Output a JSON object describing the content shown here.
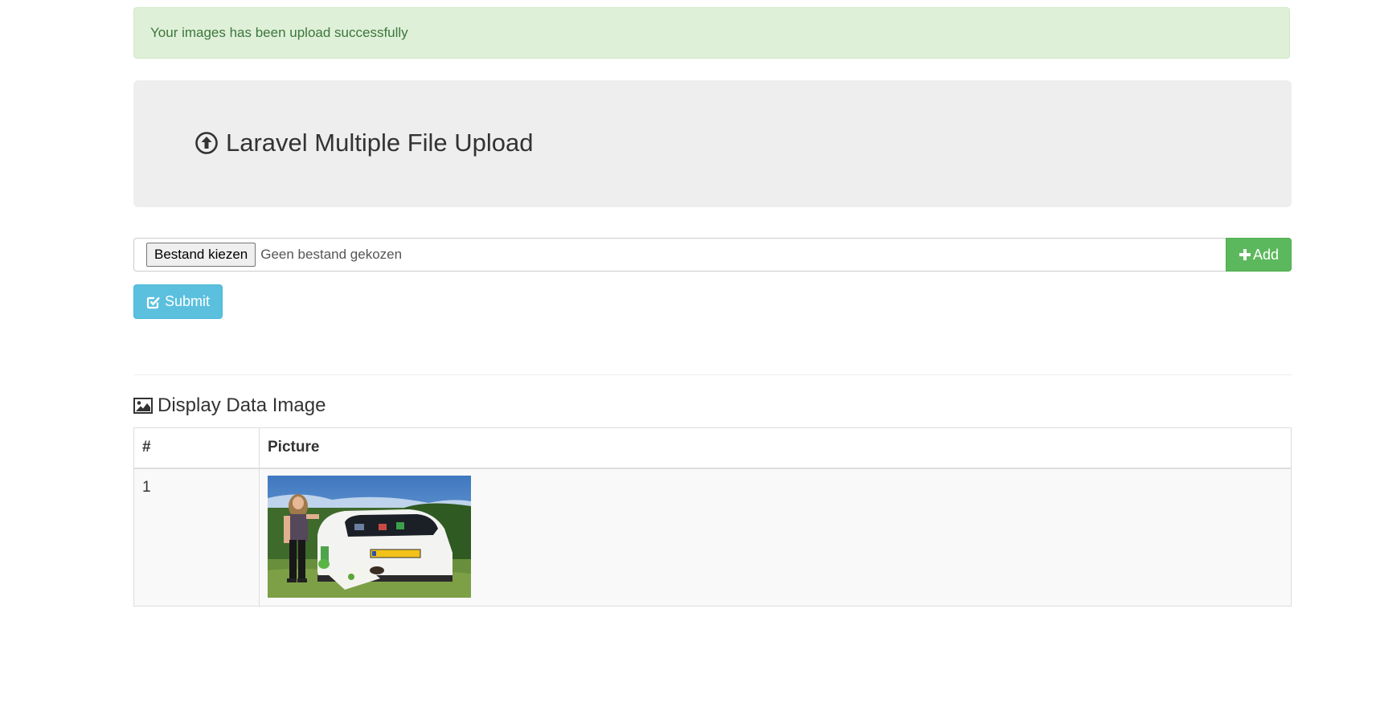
{
  "alert": {
    "message": "Your images has been upload successfully"
  },
  "jumbotron": {
    "title": "Laravel Multiple File Upload",
    "icon": "circle-arrow-up-icon"
  },
  "upload": {
    "choose_label": "Bestand kiezen",
    "no_file_text": "Geen bestand gekozen",
    "add_label": "Add",
    "add_icon": "plus-icon"
  },
  "submit": {
    "label": "Submit",
    "icon": "check-square-icon"
  },
  "section": {
    "title": "Display Data Image",
    "icon": "picture-icon"
  },
  "table": {
    "headers": [
      "#",
      "Picture"
    ],
    "rows": [
      {
        "num": "1",
        "picture": "photo-woman-with-white-car"
      }
    ]
  },
  "colors": {
    "success_bg": "#dff0d8",
    "success_text": "#3c763d",
    "add_green": "#5cb85c",
    "submit_blue": "#5bc0de",
    "jumbotron_bg": "#eeeeee"
  }
}
